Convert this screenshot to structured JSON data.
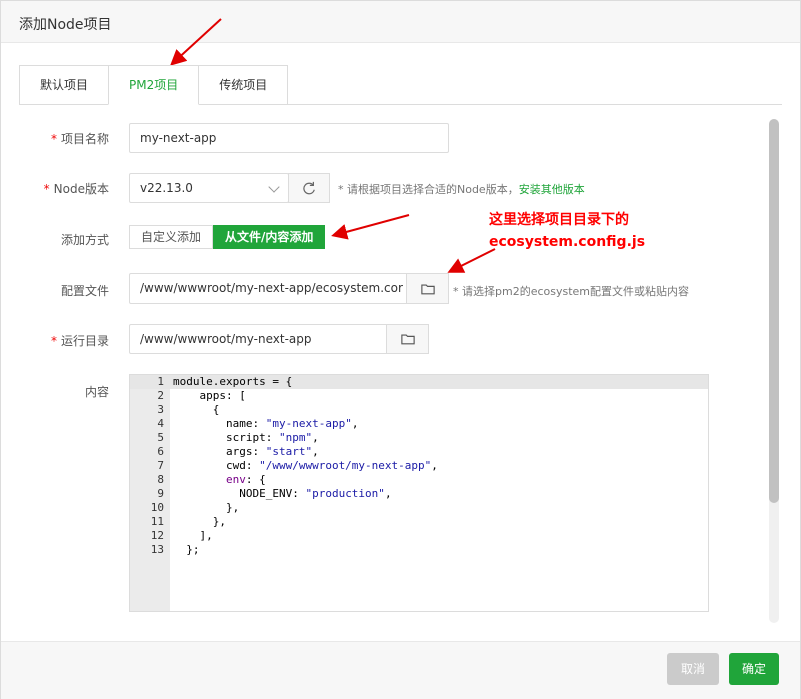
{
  "dialog": {
    "title": "添加Node项目"
  },
  "tabs": [
    {
      "label": "默认项目",
      "active": false
    },
    {
      "label": "PM2项目",
      "active": true
    },
    {
      "label": "传统项目",
      "active": false
    }
  ],
  "form": {
    "name": {
      "label": "项目名称",
      "required": true,
      "value": "my-next-app"
    },
    "node_version": {
      "label": "Node版本",
      "required": true,
      "value": "v22.13.0",
      "hint_prefix": "* 请根据项目选择合适的Node版本，",
      "hint_link": "安装其他版本",
      "refresh_icon": "refresh-icon"
    },
    "add_mode": {
      "label": "添加方式",
      "options": [
        "自定义添加",
        "从文件/内容添加"
      ],
      "selected": "从文件/内容添加"
    },
    "config_file": {
      "label": "配置文件",
      "value": "/www/wwwroot/my-next-app/ecosystem.cor",
      "hint": "* 请选择pm2的ecosystem配置文件或粘贴内容",
      "icon": "folder-icon"
    },
    "run_dir": {
      "label": "运行目录",
      "required": true,
      "value": "/www/wwwroot/my-next-app",
      "icon": "folder-icon"
    },
    "content": {
      "label": "内容"
    }
  },
  "editor": {
    "lines": [
      {
        "n": "1",
        "parts": [
          [
            "",
            "module.exports = {"
          ]
        ]
      },
      {
        "n": "2",
        "parts": [
          [
            "",
            "    apps: ["
          ]
        ]
      },
      {
        "n": "3",
        "parts": [
          [
            "",
            "      {"
          ]
        ]
      },
      {
        "n": "4",
        "parts": [
          [
            "",
            "        name: "
          ],
          [
            "str",
            "\"my-next-app\""
          ],
          [
            "",
            ","
          ]
        ]
      },
      {
        "n": "5",
        "parts": [
          [
            "",
            "        script: "
          ],
          [
            "str",
            "\"npm\""
          ],
          [
            "",
            ","
          ]
        ]
      },
      {
        "n": "6",
        "parts": [
          [
            "",
            "        args: "
          ],
          [
            "str",
            "\"start\""
          ],
          [
            "",
            ","
          ]
        ]
      },
      {
        "n": "7",
        "parts": [
          [
            "",
            "        cwd: "
          ],
          [
            "str",
            "\"/www/wwwroot/my-next-app\""
          ],
          [
            "",
            ","
          ]
        ]
      },
      {
        "n": "8",
        "parts": [
          [
            "kw",
            "        env"
          ],
          [
            "",
            ": {"
          ]
        ]
      },
      {
        "n": "9",
        "parts": [
          [
            "",
            "          NODE_ENV: "
          ],
          [
            "str",
            "\"production\""
          ],
          [
            "",
            ","
          ]
        ]
      },
      {
        "n": "10",
        "parts": [
          [
            "",
            "        },"
          ]
        ]
      },
      {
        "n": "11",
        "parts": [
          [
            "",
            "      },"
          ]
        ]
      },
      {
        "n": "12",
        "parts": [
          [
            "",
            "    ],"
          ]
        ]
      },
      {
        "n": "13",
        "parts": [
          [
            "",
            "  };"
          ]
        ]
      }
    ]
  },
  "annotation": {
    "line1": "这里选择项目目录下的",
    "line2": "ecosystem.config.js"
  },
  "footer": {
    "cancel_label": "取消",
    "ok_label": "确定"
  },
  "colors": {
    "accent": "#20a53a",
    "required": "#ef0808",
    "annotation": "#ff0000"
  }
}
